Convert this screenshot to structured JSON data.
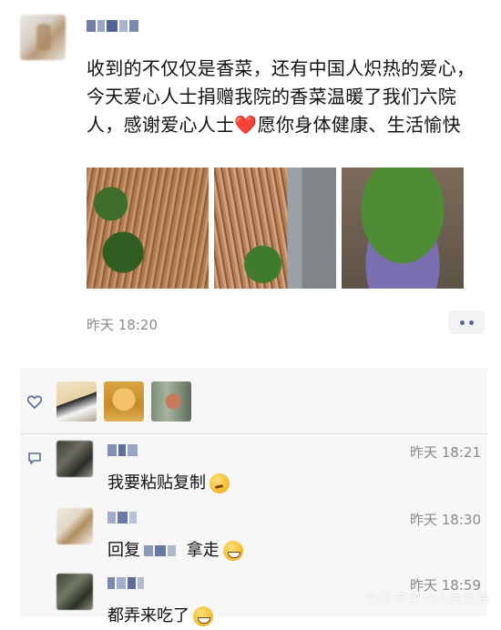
{
  "post": {
    "text": "收到的不仅仅是香菜，还有中国人炽热的爱心，今天爱心人士捐赠我院的香菜温暖了我们六院人，感谢爱心人士",
    "text_emoji": "❤️",
    "text_tail": "愿你身体健康、生活愉快",
    "time": "昨天 18:20",
    "photos": [
      "coriander-photo",
      "coriander-photo",
      "coriander-photo"
    ]
  },
  "likes": {
    "icon": "heart-outline-icon",
    "count_avatars": 3
  },
  "comments": [
    {
      "time": "昨天 18:21",
      "text": "我要粘贴复制",
      "emoji": "thinking-emoji"
    },
    {
      "time": "昨天 18:30",
      "reply_prefix": "回复",
      "text": "拿走",
      "emoji": "grin-emoji"
    },
    {
      "time": "昨天 18:59",
      "text": "都弄来吃了",
      "emoji": "grin-emoji"
    }
  ],
  "watermark": "内江市第六人民医院",
  "colors": {
    "link": "#576b95",
    "panel": "#f7f7f7",
    "time": "#8a8a8a"
  }
}
